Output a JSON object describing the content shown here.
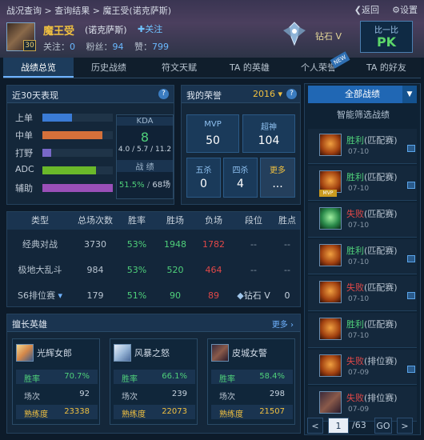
{
  "header": {
    "breadcrumb": [
      "战况查询",
      "查询结果",
      "魔王受(诺克萨斯)"
    ],
    "back": "返回",
    "settings": "设置",
    "level": "30",
    "player_name": "魔王受",
    "server": "(诺克萨斯)",
    "follow": "关注",
    "follow_label": "关注：",
    "follow_count": "0",
    "fans_label": "粉丝：",
    "fans_count": "94",
    "likes_label": "赞：",
    "likes_count": "799",
    "rank": "钻石 V",
    "pk_top": "比一比",
    "pk": "PK"
  },
  "tabs": [
    {
      "label": "战绩总览",
      "active": true
    },
    {
      "label": "历史战绩"
    },
    {
      "label": "符文天赋"
    },
    {
      "label": "TA 的英雄"
    },
    {
      "label": "个人荣誉"
    },
    {
      "label": "TA 的好友"
    }
  ],
  "new_badge": "NEW",
  "recent": {
    "title": "近30天表现",
    "positions": [
      {
        "name": "上单",
        "level": 0.42,
        "color": "#3a7bd5"
      },
      {
        "name": "中单",
        "level": 0.85,
        "color": "#d4703a"
      },
      {
        "name": "打野",
        "level": 0.13,
        "color": "#7868c8"
      },
      {
        "name": "ADC",
        "level": 0.76,
        "color": "#6ab82a"
      },
      {
        "name": "辅助",
        "level": 1.0,
        "color": "#9a4fb8"
      }
    ],
    "kda_label": "KDA",
    "kda": "8",
    "kda_detail": "4.0 / 5.7 / 11.2",
    "record_label": "战 绩",
    "winrate": "51.5%",
    "games": "68场"
  },
  "honor": {
    "title": "我的荣誉",
    "year": "2016",
    "mvp_label": "MVP",
    "mvp": "50",
    "god_label": "超神",
    "god": "104",
    "penta_label": "五杀",
    "penta": "0",
    "quadra_label": "四杀",
    "quadra": "4",
    "more_label": "更多",
    "more": "..."
  },
  "table": {
    "headers": [
      "类型",
      "总场次数",
      "胜率",
      "胜场",
      "负场",
      "段位",
      "胜点"
    ],
    "rows": [
      {
        "type": "经典对战",
        "total": "3730",
        "rate": "53%",
        "win": "1948",
        "lose": "1782",
        "rank": "--",
        "points": "--"
      },
      {
        "type": "极地大乱斗",
        "total": "984",
        "rate": "53%",
        "win": "520",
        "lose": "464",
        "rank": "--",
        "points": "--"
      },
      {
        "type": "S6排位赛",
        "total": "179",
        "rate": "51%",
        "win": "90",
        "lose": "89",
        "rank": "钻石 V",
        "points": "0"
      }
    ]
  },
  "heroes": {
    "title": "擅长英雄",
    "more": "更多",
    "items": [
      {
        "name": "光辉女郎",
        "winrate_label": "胜率",
        "winrate": "70.7%",
        "games_label": "场次",
        "games": "92",
        "mastery_label": "熟练度",
        "mastery": "23338"
      },
      {
        "name": "风暴之怒",
        "winrate_label": "胜率",
        "winrate": "66.1%",
        "games_label": "场次",
        "games": "239",
        "mastery_label": "熟练度",
        "mastery": "22073"
      },
      {
        "name": "皮城女警",
        "winrate_label": "胜率",
        "winrate": "58.4%",
        "games_label": "场次",
        "games": "298",
        "mastery_label": "熟练度",
        "mastery": "21507"
      }
    ]
  },
  "battles": {
    "all": "全部战绩",
    "filter": "智能筛选战绩",
    "items": [
      {
        "result": "胜利",
        "mode": "(匹配赛)",
        "date": "07-10",
        "win": true
      },
      {
        "result": "胜利",
        "mode": "(匹配赛)",
        "date": "07-10",
        "win": true,
        "mvp": "MVP"
      },
      {
        "result": "失败",
        "mode": "(匹配赛)",
        "date": "07-10",
        "win": false
      },
      {
        "result": "胜利",
        "mode": "(匹配赛)",
        "date": "07-10",
        "win": true
      },
      {
        "result": "失败",
        "mode": "(匹配赛)",
        "date": "07-10",
        "win": false
      },
      {
        "result": "胜利",
        "mode": "(匹配赛)",
        "date": "07-10",
        "win": true
      },
      {
        "result": "失败",
        "mode": "(排位赛)",
        "date": "07-09",
        "win": false
      },
      {
        "result": "失败",
        "mode": "(排位赛)",
        "date": "07-09",
        "win": false
      }
    ]
  },
  "pager": {
    "prev": "<",
    "page": "1",
    "total": "/63",
    "go": "GO",
    "next": ">"
  }
}
